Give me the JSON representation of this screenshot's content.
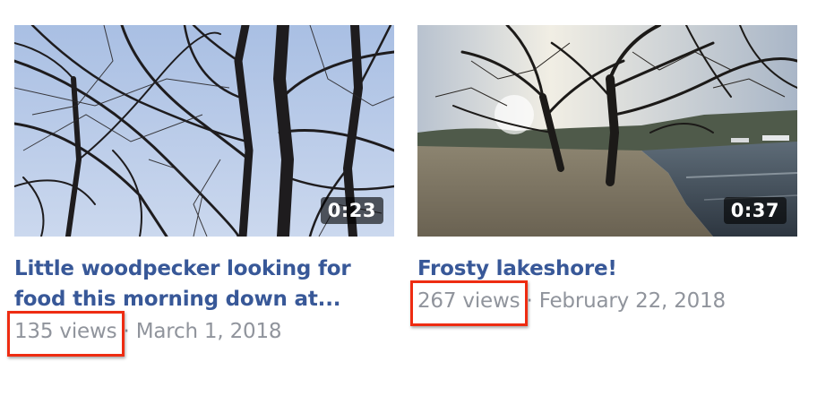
{
  "videos": [
    {
      "thumbnail_scene": "bare tree branches against pale blue sky",
      "duration": "0:23",
      "title_line1": "Little woodpecker looking for",
      "title_line2": "food this morning down at...",
      "views": "135 views",
      "separator": " · ",
      "date": "March 1, 2018",
      "highlighted": "views"
    },
    {
      "thumbnail_scene": "frosty lakeshore with trees at sunrise",
      "duration": "0:37",
      "title_line1": "Frosty lakeshore!",
      "views": "267 views",
      "separator": " · ",
      "date": "February 22, 2018",
      "highlighted": "views"
    }
  ],
  "colors": {
    "title": "#385898",
    "meta": "#90949c",
    "highlight": "#ee2c12"
  }
}
